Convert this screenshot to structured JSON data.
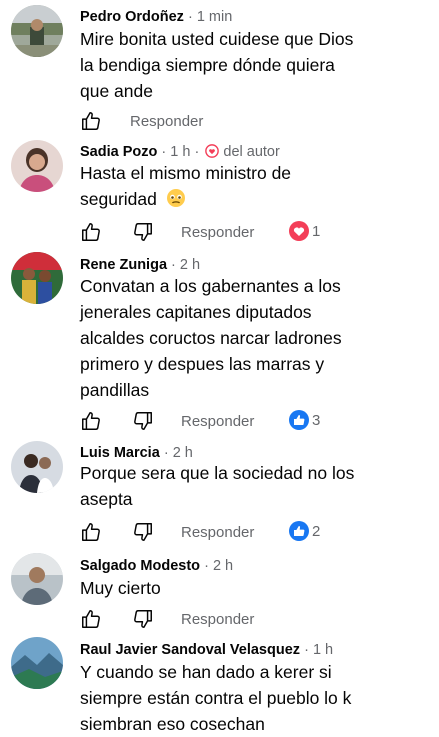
{
  "comments": [
    {
      "author": "Pedro Ordoñez",
      "time": "1 min",
      "lines": [
        "Mire bonita usted cuidese que Dios",
        "la bendiga siempre dónde quiera",
        "que ande"
      ],
      "reply_label": "Responder",
      "avatar_icon": "profile-photo"
    },
    {
      "author": "Sadia Pozo",
      "time": "1 h",
      "badge": "del autor",
      "badge_icon": "heart-outline-icon",
      "lines": [
        "Hasta el mismo ministro de",
        "seguridad"
      ],
      "emoji": "worried-face-emoji",
      "reply_label": "Responder",
      "reaction": {
        "type": "love",
        "icon": "love-reaction-icon",
        "color": "#f33e58",
        "count": "1"
      },
      "avatar_icon": "profile-photo"
    },
    {
      "author": "Rene Zuniga",
      "time": "2 h",
      "lines": [
        "Convatan a los gabernantes a los",
        "jenerales capitanes diputados",
        "alcaldes coructos narcar ladrones",
        "primero y despues las marras y",
        "pandillas"
      ],
      "reply_label": "Responder",
      "reaction": {
        "type": "like",
        "icon": "like-reaction-icon",
        "color": "#1877f2",
        "count": "3"
      },
      "avatar_icon": "profile-photo"
    },
    {
      "author": "Luis Marcia",
      "time": "2 h",
      "lines": [
        "Porque sera que la sociedad no los",
        "asepta"
      ],
      "reply_label": "Responder",
      "reaction": {
        "type": "like",
        "icon": "like-reaction-icon",
        "color": "#1877f2",
        "count": "2"
      },
      "avatar_icon": "profile-photo"
    },
    {
      "author": "Salgado Modesto",
      "time": "2 h",
      "lines": [
        "Muy cierto"
      ],
      "reply_label": "Responder",
      "avatar_icon": "profile-photo"
    },
    {
      "author": "Raul Javier Sandoval Velasquez",
      "time": "1 h",
      "lines": [
        "Y cuando se han dado a kerer si",
        "siempre están contra el pueblo lo k",
        "siembran eso cosechan"
      ],
      "avatar_icon": "profile-photo"
    }
  ],
  "separator": "·",
  "colors": {
    "secondary_text": "#65676b",
    "primary_text": "#050505",
    "like_blue": "#1877f2",
    "love_red": "#f33e58"
  }
}
